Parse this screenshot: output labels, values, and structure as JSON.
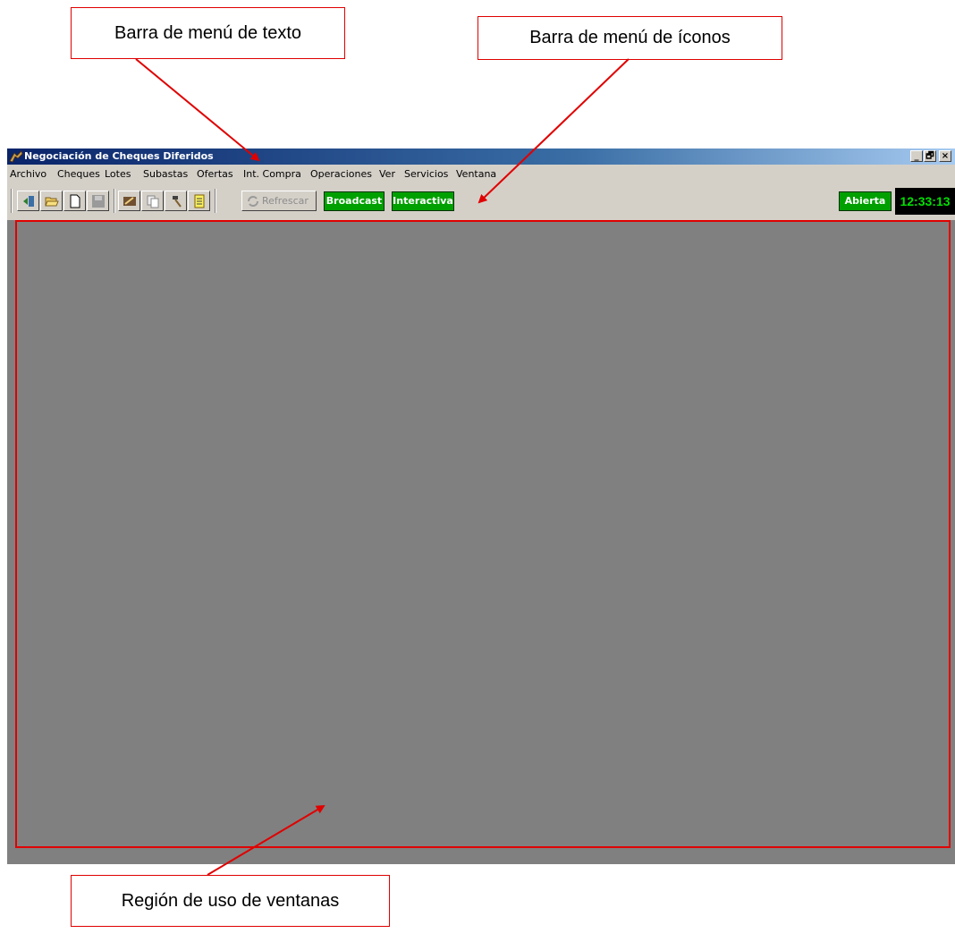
{
  "annotations": {
    "text_menu_bar": "Barra de menú de texto",
    "icon_menu_bar": "Barra de menú de íconos",
    "window_region": "Región de uso de ventanas"
  },
  "window": {
    "title": "Negociación de Cheques Diferidos",
    "controls": [
      "_",
      "🗗",
      "×"
    ]
  },
  "menu": [
    "Archivo",
    "Cheques",
    "Lotes",
    "Subastas",
    "Ofertas",
    "Int. Compra",
    "Operaciones",
    "Ver",
    "Servicios",
    "Ventana"
  ],
  "toolbar": {
    "icons": [
      "exit-icon",
      "open-folder-icon",
      "new-document-icon",
      "save-icon",
      "edit-check-icon",
      "copy-icon",
      "hammer-icon",
      "notepad-icon"
    ],
    "refresh_label": "Refrescar",
    "broadcast_label": "Broadcast",
    "interactive_label": "Interactiva",
    "status_label": "Abierta",
    "clock": "12:33:13"
  },
  "colors": {
    "annotation": "#e00000",
    "status_green": "#00a000",
    "clock_text": "#00e000",
    "workspace": "#808080"
  }
}
